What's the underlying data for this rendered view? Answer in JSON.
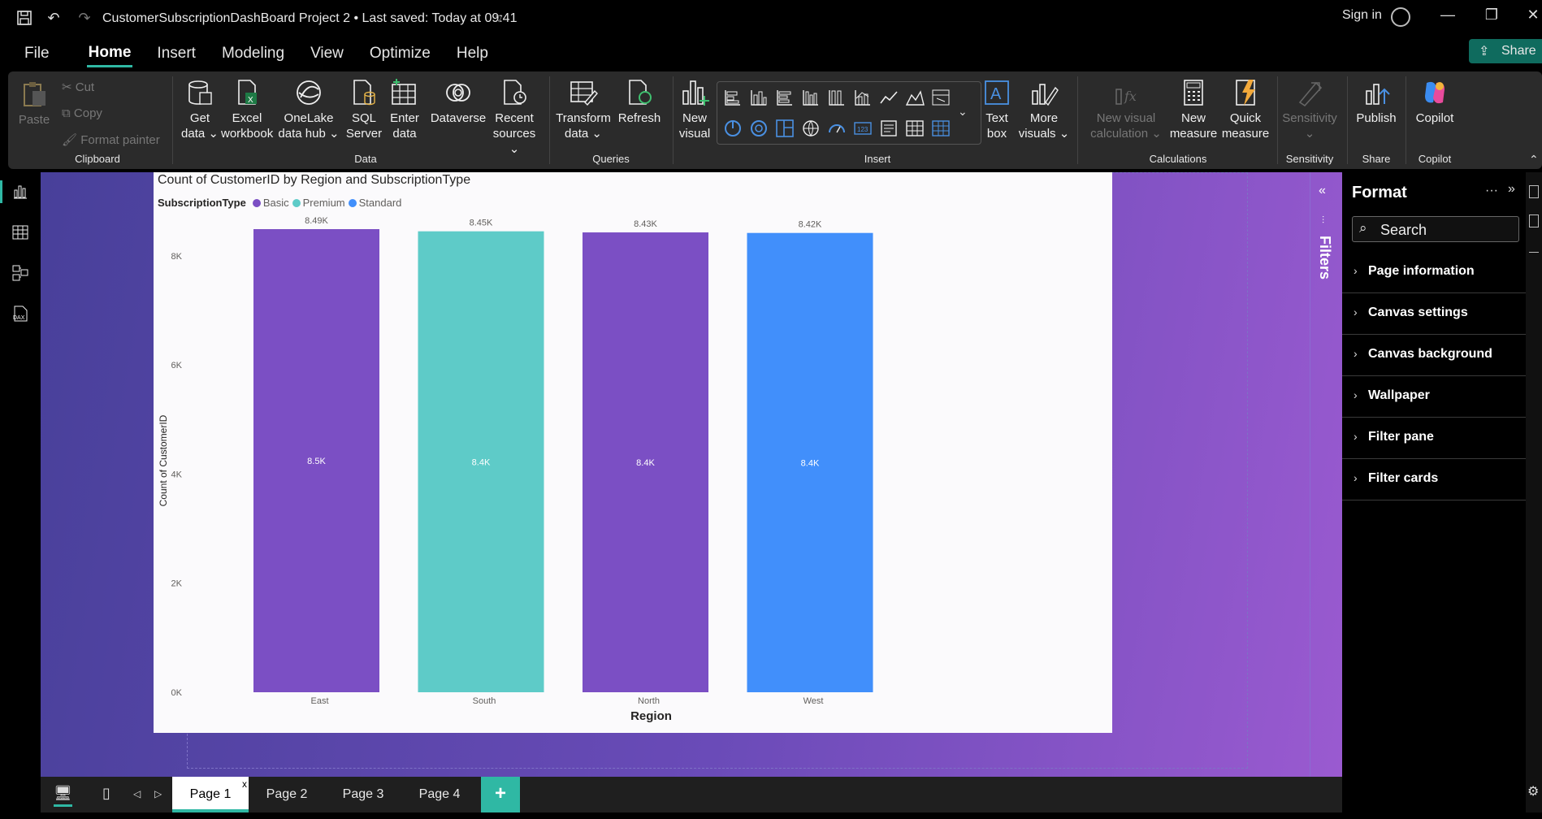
{
  "titlebar": {
    "title": "CustomerSubscriptionDashBoard Project 2 • Last saved: Today at 09:41",
    "sign_in": "Sign in"
  },
  "menu": {
    "items": [
      "File",
      "Home",
      "Insert",
      "Modeling",
      "View",
      "Optimize",
      "Help"
    ],
    "share": "Share"
  },
  "ribbon": {
    "clipboard": {
      "paste": "Paste",
      "cut": "Cut",
      "copy": "Copy",
      "format_painter": "Format painter",
      "label": "Clipboard"
    },
    "data": {
      "get_data": [
        "Get",
        "data"
      ],
      "excel": [
        "Excel",
        "workbook"
      ],
      "onelake": [
        "OneLake",
        "data hub"
      ],
      "sql": [
        "SQL",
        "Server"
      ],
      "enter": [
        "Enter",
        "data"
      ],
      "dataverse": "Dataverse",
      "recent": [
        "Recent",
        "sources"
      ],
      "label": "Data"
    },
    "queries": {
      "transform": [
        "Transform",
        "data"
      ],
      "refresh": "Refresh",
      "label": "Queries"
    },
    "insert": {
      "new_visual": [
        "New",
        "visual"
      ],
      "text_box": [
        "Text",
        "box"
      ],
      "more_visuals": [
        "More",
        "visuals"
      ],
      "label": "Insert"
    },
    "calculations": {
      "new_visual_calc": [
        "New visual",
        "calculation"
      ],
      "new_measure": [
        "New",
        "measure"
      ],
      "quick_measure": [
        "Quick",
        "measure"
      ],
      "label": "Calculations"
    },
    "sensitivity": {
      "btn": "Sensitivity",
      "label": "Sensitivity"
    },
    "share": {
      "publish": "Publish",
      "label": "Share"
    },
    "copilot": {
      "btn": "Copilot",
      "label": "Copilot"
    }
  },
  "visual": {
    "title": "Count of CustomerID by Region and SubscriptionType",
    "legend_title": "SubscriptionType",
    "legend": [
      {
        "name": "Basic",
        "color": "#7b4fc4"
      },
      {
        "name": "Premium",
        "color": "#5ecbc8"
      },
      {
        "name": "Standard",
        "color": "#418ffb"
      }
    ]
  },
  "chart_data": {
    "type": "bar",
    "title": "Count of CustomerID by Region and SubscriptionType",
    "xlabel": "Region",
    "ylabel": "Count of CustomerID",
    "categories": [
      "East",
      "South",
      "North",
      "West"
    ],
    "values": [
      8490,
      8450,
      8430,
      8420
    ],
    "top_labels": [
      "8.49K",
      "8.45K",
      "8.43K",
      "8.42K"
    ],
    "inner_labels": [
      "8.5K",
      "8.4K",
      "8.4K",
      "8.4K"
    ],
    "bar_series": [
      "Basic",
      "Premium",
      "Basic",
      "Standard"
    ],
    "yticks": [
      0,
      2000,
      4000,
      6000,
      8000
    ],
    "ytick_labels": [
      "0K",
      "2K",
      "4K",
      "6K",
      "8K"
    ],
    "ylim": [
      0,
      8490
    ],
    "legend_position": "top-left",
    "grid": false
  },
  "filters_pane": {
    "label": "Filters"
  },
  "format_pane": {
    "title": "Format",
    "search_placeholder": "Search",
    "sections": [
      "Page information",
      "Canvas settings",
      "Canvas background",
      "Wallpaper",
      "Filter pane",
      "Filter cards"
    ]
  },
  "pages": {
    "tabs": [
      "Page 1",
      "Page 2",
      "Page 3",
      "Page 4"
    ],
    "active": 0,
    "close": "x",
    "add": "+"
  }
}
